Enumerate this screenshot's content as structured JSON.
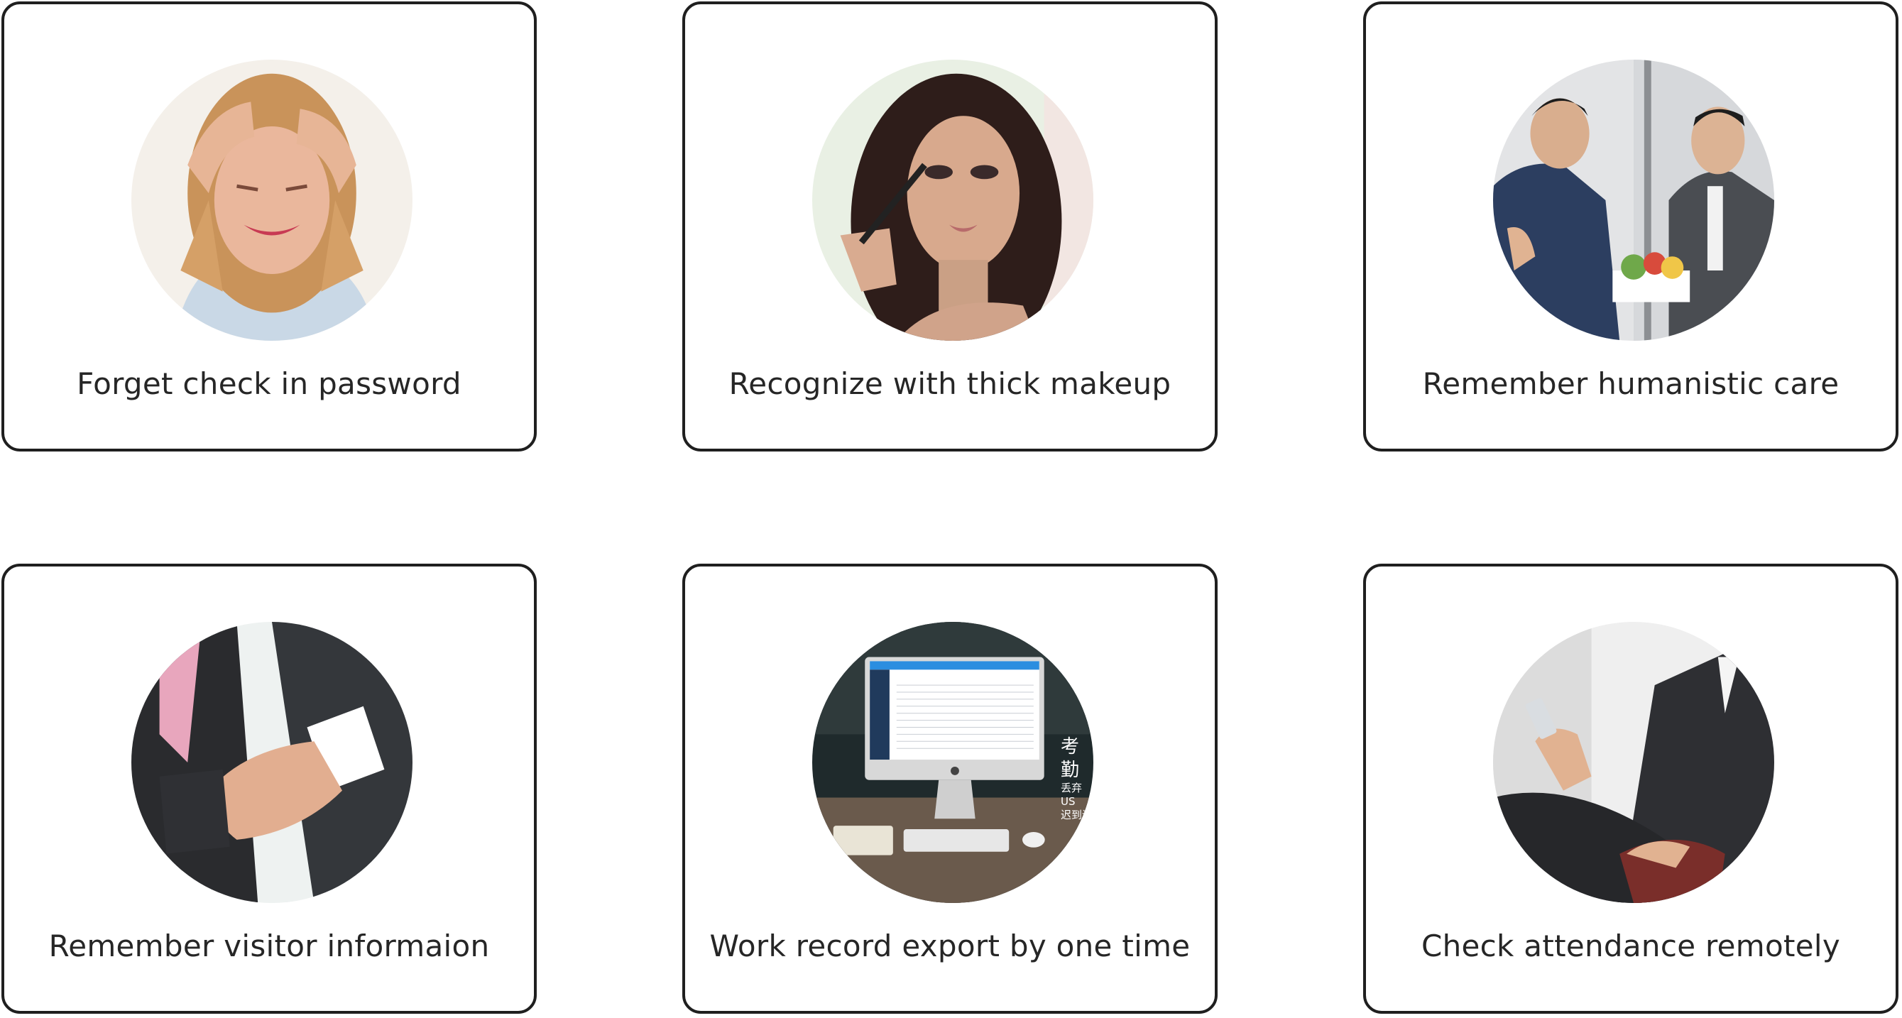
{
  "cards": [
    {
      "caption": "Forget check in password",
      "image": "stressed-woman-photo"
    },
    {
      "caption": "Recognize with thick makeup",
      "image": "woman-applying-makeup-photo"
    },
    {
      "caption": "Remember humanistic care",
      "image": "office-gift-presentation-photo"
    },
    {
      "caption": "Remember visitor informaion",
      "image": "business-handshake-photo"
    },
    {
      "caption": "Work record export by one time",
      "image": "desktop-computer-photo",
      "image_text": [
        "考勤",
        "丢弃US",
        "迟到请"
      ]
    },
    {
      "caption": "Check attendance remotely",
      "image": "businessman-using-phone-photo"
    }
  ],
  "colors": {
    "card_border": "#1f1f1f",
    "caption_text": "#262626",
    "background": "#ffffff"
  }
}
